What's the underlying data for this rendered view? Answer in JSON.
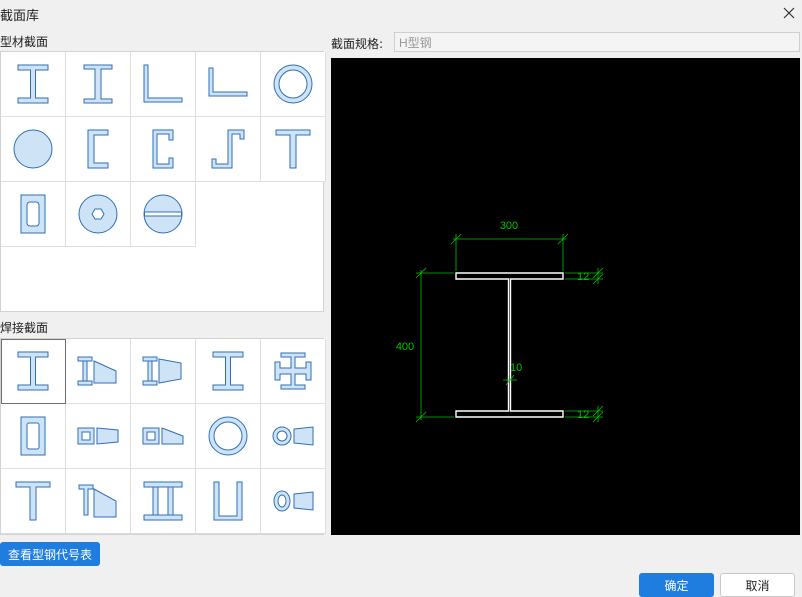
{
  "dialog": {
    "title": "截面库"
  },
  "sections": {
    "profile_label": "型材截面",
    "welded_label": "焊接截面"
  },
  "spec": {
    "label": "截面规格:",
    "value": "H型钢"
  },
  "drawing": {
    "width": "300",
    "height": "400",
    "web": "10",
    "flange_top": "12",
    "flange_bottom": "12"
  },
  "buttons": {
    "table": "查看型钢代号表",
    "ok": "确定",
    "cancel": "取消"
  },
  "colors": {
    "accent": "#1f7de0",
    "icon_fill": "#cfe3f7",
    "icon_stroke": "#2f6fb5",
    "dim": "#00c400"
  }
}
